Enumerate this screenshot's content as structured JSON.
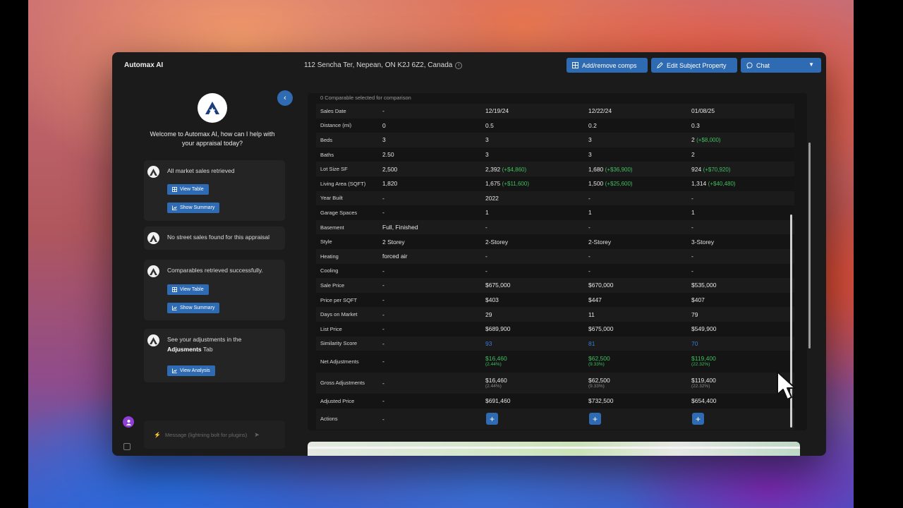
{
  "app": {
    "title": "Automax AI",
    "address": "112 Sencha Ter, Nepean, ON K2J 6Z2, Canada"
  },
  "header_buttons": {
    "add_remove": "Add/remove comps",
    "edit_subject": "Edit Subject Property",
    "chat": "Chat"
  },
  "sidebar": {
    "welcome": "Welcome to Automax AI, how can I help with your appraisal today?",
    "cards": [
      {
        "text": "All market sales retrieved",
        "buttons": [
          "View Table",
          "Show Summary"
        ]
      },
      {
        "text": "No street sales found for this appraisal",
        "buttons": []
      },
      {
        "text": "Comparables retrieved successfully.",
        "buttons": [
          "View Table",
          "Show Summary"
        ]
      },
      {
        "text": "See your adjustments in the",
        "bold": "Adjusments",
        "suffix": " Tab",
        "buttons": [
          "View Analysis"
        ]
      }
    ],
    "input_placeholder": "Message (lightning bolt for plugins)"
  },
  "comparison": {
    "caption": "0 Comparable selected for comparison",
    "rows": [
      {
        "label": "Sales Date",
        "subject": "-",
        "c1": "12/19/24",
        "c2": "12/22/24",
        "c3": "01/08/25"
      },
      {
        "label": "Distance (mi)",
        "subject": "0",
        "c1": "0.5",
        "c2": "0.2",
        "c3": "0.3"
      },
      {
        "label": "Beds",
        "subject": "3",
        "c1": "3",
        "c2": "3",
        "c3": "2",
        "c3_adj": "(+$8,000)"
      },
      {
        "label": "Baths",
        "subject": "2.50",
        "c1": "3",
        "c2": "3",
        "c3": "2"
      },
      {
        "label": "Lot Size SF",
        "subject": "2,500",
        "c1": "2,392",
        "c1_adj": "(+$4,860)",
        "c2": "1,680",
        "c2_adj": "(+$36,900)",
        "c3": "924",
        "c3_adj": "(+$70,920)"
      },
      {
        "label": "Living Area (SQFT)",
        "subject": "1,820",
        "c1": "1,675",
        "c1_adj": "(+$11,600)",
        "c2": "1,500",
        "c2_adj": "(+$25,600)",
        "c3": "1,314",
        "c3_adj": "(+$40,480)"
      },
      {
        "label": "Year Built",
        "subject": "-",
        "c1": "2022",
        "c2": "-",
        "c3": "-"
      },
      {
        "label": "Garage Spaces",
        "subject": "-",
        "c1": "1",
        "c2": "1",
        "c3": "1"
      },
      {
        "label": "Basement",
        "subject": "Full, Finished",
        "c1": "-",
        "c2": "-",
        "c3": "-"
      },
      {
        "label": "Style",
        "subject": "2 Storey",
        "c1": "2-Storey",
        "c2": "2-Storey",
        "c3": "3-Storey"
      },
      {
        "label": "Heating",
        "subject": "forced air",
        "c1": "-",
        "c2": "-",
        "c3": "-"
      },
      {
        "label": "Cooling",
        "subject": "-",
        "c1": "-",
        "c2": "-",
        "c3": "-"
      },
      {
        "label": "Sale Price",
        "subject": "-",
        "c1": "$675,000",
        "c2": "$670,000",
        "c3": "$535,000"
      },
      {
        "label": "Price per SQFT",
        "subject": "-",
        "c1": "$403",
        "c2": "$447",
        "c3": "$407"
      },
      {
        "label": "Days on Market",
        "subject": "-",
        "c1": "29",
        "c2": "11",
        "c3": "79"
      },
      {
        "label": "List Price",
        "subject": "-",
        "c1": "$689,900",
        "c2": "$675,000",
        "c3": "$549,900"
      },
      {
        "label": "Similarity Score",
        "subject": "-",
        "c1": "93",
        "c2": "81",
        "c3": "70"
      }
    ],
    "net_adjustments": {
      "label": "Net Adjustments",
      "subject": "-",
      "c1": "$16,460",
      "c1_pct": "(2.44%)",
      "c2": "$62,500",
      "c2_pct": "(9.33%)",
      "c3": "$119,400",
      "c3_pct": "(22.32%)"
    },
    "gross_adjustments": {
      "label": "Gross Adjustments",
      "subject": "-",
      "c1": "$16,460",
      "c1_pct": "(2.44%)",
      "c2": "$62,500",
      "c2_pct": "(9.33%)",
      "c3": "$119,400",
      "c3_pct": "(22.32%)"
    },
    "adjusted_price": {
      "label": "Adjusted Price",
      "subject": "-",
      "c1": "$691,460",
      "c2": "$732,500",
      "c3": "$654,400"
    },
    "actions": {
      "label": "Actions",
      "subject": "-",
      "button": "+"
    }
  },
  "colors": {
    "accent": "#2f6bb3",
    "positive": "#3fbf5f",
    "score": "#3a7bd5",
    "window_bg": "#1b1b1c"
  }
}
